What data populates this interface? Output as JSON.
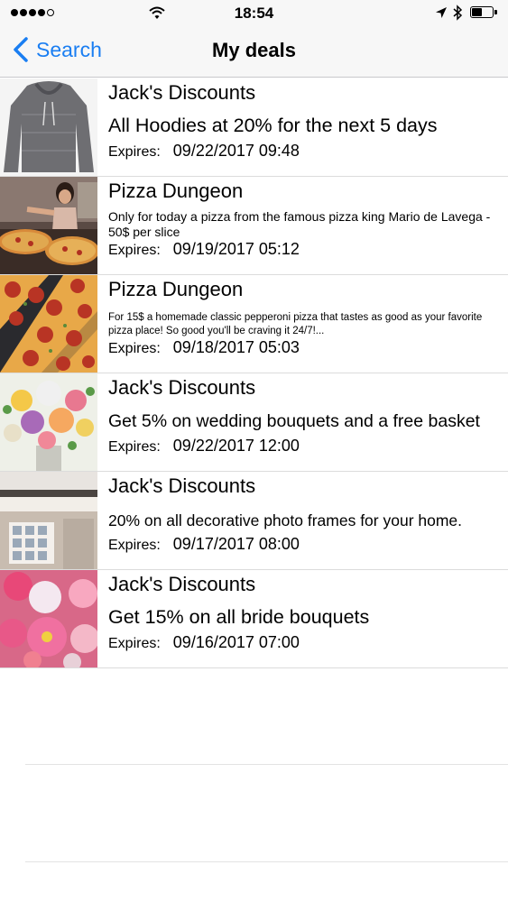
{
  "status_bar": {
    "time": "18:54",
    "icons": [
      "signal-dots",
      "wifi-icon",
      "location-arrow-icon",
      "bluetooth-icon",
      "battery-icon"
    ]
  },
  "nav": {
    "back_label": "Search",
    "title": "My deals"
  },
  "deals": [
    {
      "merchant": "Jack's Discounts",
      "description": "All Hoodies at 20% for the next 5 days",
      "expires_label": "Expires:",
      "expires": "09/22/2017 09:48",
      "image": "hoodie-photo"
    },
    {
      "merchant": "Pizza Dungeon",
      "description": "Only for today a pizza from the famous pizza king Mario de Lavega - 50$ per slice",
      "expires_label": "Expires:",
      "expires": "09/19/2017 05:12",
      "image": "pizza-chef-photo"
    },
    {
      "merchant": "Pizza Dungeon",
      "description": "For 15$ a homemade classic pepperoni pizza that tastes as good as your favorite pizza place! So good you'll be craving it 24/7!...",
      "expires_label": "Expires:",
      "expires": "09/18/2017 05:03",
      "image": "pepperoni-pizza-photo"
    },
    {
      "merchant": "Jack's Discounts",
      "description": "Get 5% on wedding bouquets and a free basket",
      "expires_label": "Expires:",
      "expires": "09/22/2017 12:00",
      "image": "wedding-bouquet-photo"
    },
    {
      "merchant": "Jack's Discounts",
      "description": "20% on all decorative photo frames for your home.",
      "expires_label": "Expires:",
      "expires": "09/17/2017 08:00",
      "image": "photo-frames-photo"
    },
    {
      "merchant": "Jack's Discounts",
      "description": "Get 15% on all bride bouquets",
      "expires_label": "Expires:",
      "expires": "09/16/2017 07:00",
      "image": "bride-bouquet-photo"
    }
  ],
  "colors": {
    "accent": "#1a7ef2",
    "bar_background": "#f7f7f7",
    "separator": "#dcdcdc"
  }
}
